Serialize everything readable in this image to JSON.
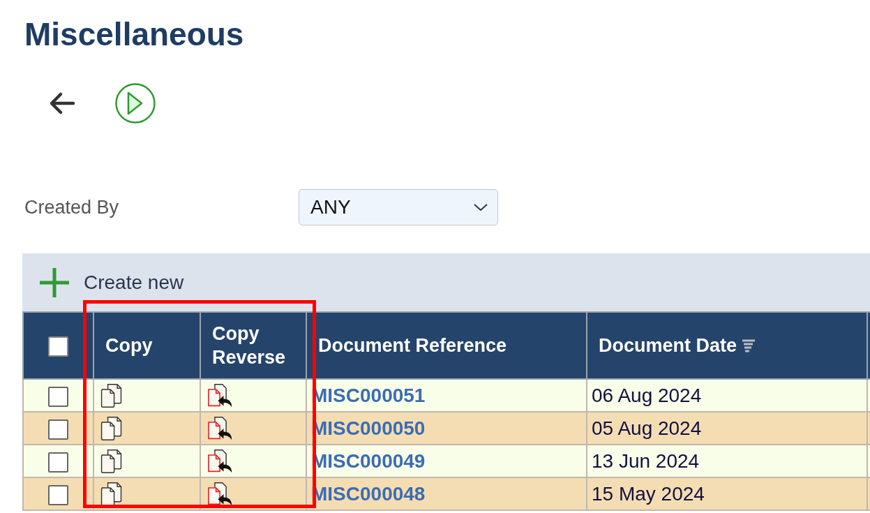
{
  "page": {
    "title": "Miscellaneous"
  },
  "filter": {
    "label": "Created By",
    "value": "ANY"
  },
  "toolbar": {
    "create_label": "Create new"
  },
  "table": {
    "columns": [
      {
        "kind": "checkbox",
        "checked": false
      },
      {
        "kind": "text",
        "label": "Copy"
      },
      {
        "kind": "text",
        "label": "Copy Reverse"
      },
      {
        "kind": "text",
        "label": "Document Reference"
      },
      {
        "kind": "sort",
        "label": "Document Date"
      }
    ],
    "rows": [
      {
        "checked": false,
        "reference": "MISC000051",
        "date": "06 Aug 2024"
      },
      {
        "checked": false,
        "reference": "MISC000050",
        "date": "05 Aug 2024"
      },
      {
        "checked": false,
        "reference": "MISC000049",
        "date": "13 Jun 2024"
      },
      {
        "checked": false,
        "reference": "MISC000048",
        "date": "15 May 2024"
      }
    ]
  },
  "highlight": {
    "on": true
  }
}
